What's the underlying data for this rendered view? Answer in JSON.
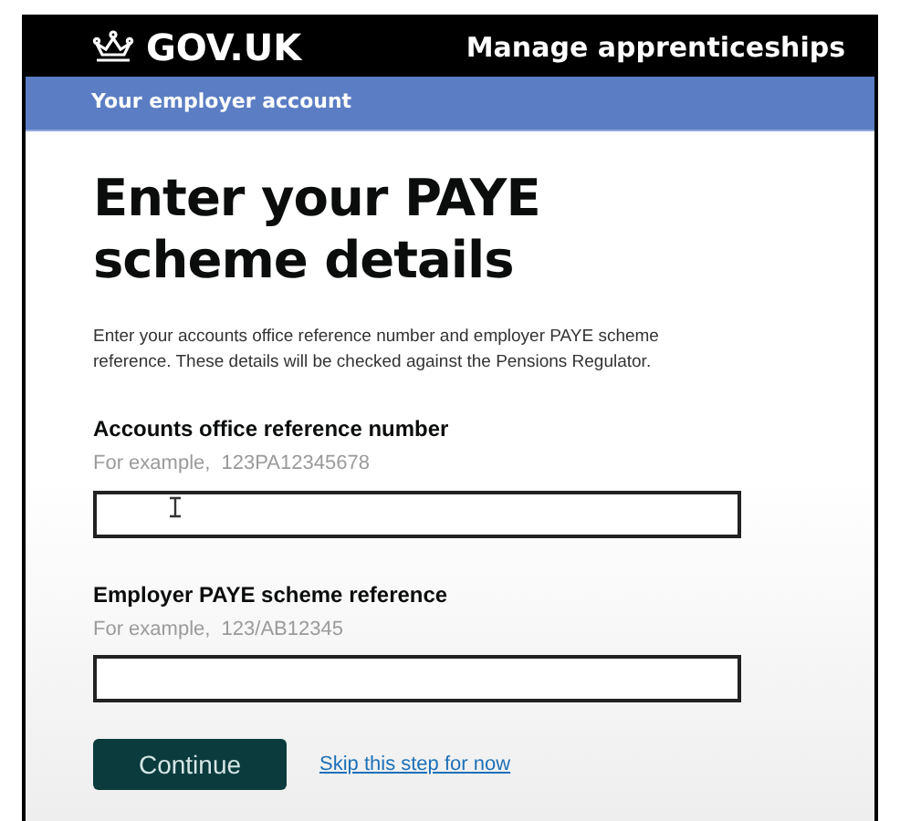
{
  "header": {
    "logo": "GOV.UK",
    "service": "Manage apprenticeships"
  },
  "subnav": {
    "label": "Your employer account"
  },
  "heading": "Enter your PAYE scheme details",
  "intro": "Enter your accounts office reference number and employer PAYE scheme reference. These details will be checked against the Pensions Regulator.",
  "fields": [
    {
      "label": "Accounts office reference number",
      "hint": "For example,  123PA12345678",
      "cursor": true
    },
    {
      "label": "Employer PAYE scheme reference",
      "hint": "For example,  123/AB12345",
      "cursor": false
    }
  ],
  "actions": {
    "button": "Continue",
    "link": "Skip this step for now"
  }
}
